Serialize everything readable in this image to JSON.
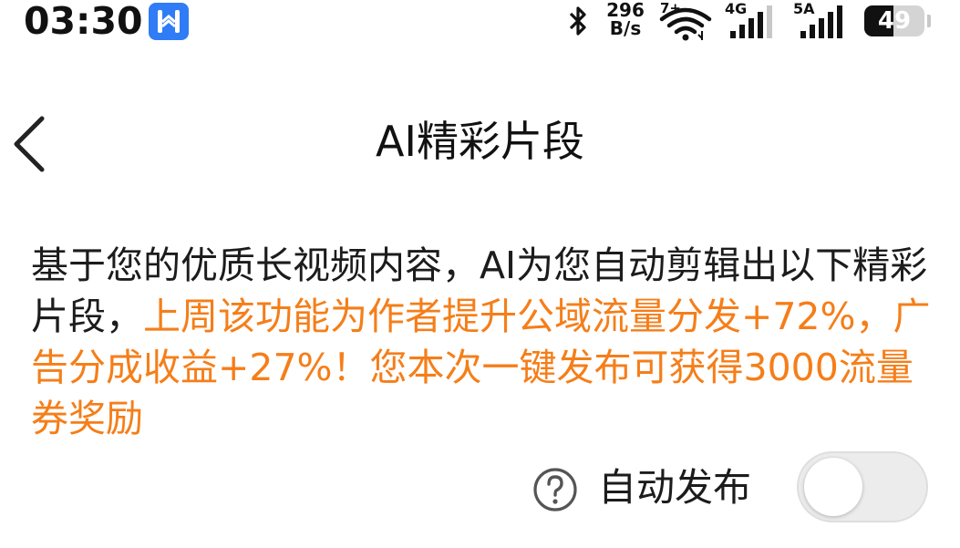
{
  "status_bar": {
    "time": "03:30",
    "net_speed_value": "296",
    "net_speed_unit": "B/s",
    "wifi_label": "7+",
    "signal1_label": "4G",
    "signal2_label": "5A",
    "battery_level": "49",
    "icons": [
      "app-notification-icon",
      "bluetooth-icon",
      "wifi-icon",
      "signal-icon",
      "battery-icon"
    ]
  },
  "header": {
    "title": "AI精彩片段",
    "back_icon": "chevron-left-icon"
  },
  "description": {
    "intro": "基于您的优质长视频内容，AI为您自动剪辑出以下精彩片段，",
    "highlight": "上周该功能为作者提升公域流量分发+72%，广告分成收益+27%！您本次一键发布可获得3000流量券奖励"
  },
  "auto_publish": {
    "label": "自动发布",
    "help_icon": "question-circle-icon",
    "enabled": false
  },
  "colors": {
    "highlight": "#f57e19",
    "app_badge": "#2f7cf6",
    "toggle_off": "#ececec"
  }
}
